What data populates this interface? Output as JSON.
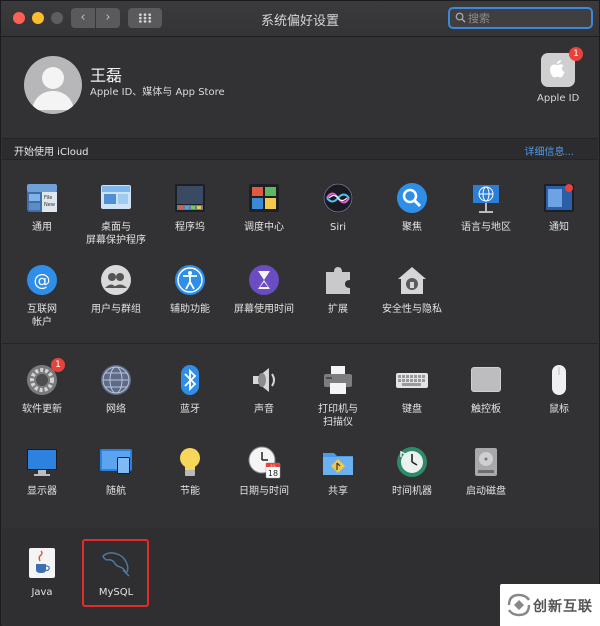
{
  "window": {
    "title": "系统偏好设置",
    "search_placeholder": "搜索"
  },
  "account": {
    "name": "王磊",
    "subtitle": "Apple ID、媒体与 App Store",
    "appleid_label": "Apple ID",
    "appleid_badge": "1"
  },
  "icloud": {
    "text": "开始使用 iCloud",
    "link": "详细信息..."
  },
  "row1": [
    {
      "label": "通用"
    },
    {
      "label": "桌面与\n屏幕保护程序"
    },
    {
      "label": "程序坞"
    },
    {
      "label": "调度中心"
    },
    {
      "label": "Siri"
    },
    {
      "label": "聚焦"
    },
    {
      "label": "语言与地区"
    },
    {
      "label": "通知"
    }
  ],
  "row2": [
    {
      "label": "互联网\n帐户"
    },
    {
      "label": "用户与群组"
    },
    {
      "label": "辅助功能"
    },
    {
      "label": "屏幕使用时间"
    },
    {
      "label": "扩展"
    },
    {
      "label": "安全性与隐私"
    }
  ],
  "row3": [
    {
      "label": "软件更新",
      "badge": "1"
    },
    {
      "label": "网络"
    },
    {
      "label": "蓝牙"
    },
    {
      "label": "声音"
    },
    {
      "label": "打印机与\n扫描仪"
    },
    {
      "label": "键盘"
    },
    {
      "label": "触控板"
    },
    {
      "label": "鼠标"
    }
  ],
  "row4": [
    {
      "label": "显示器"
    },
    {
      "label": "随航"
    },
    {
      "label": "节能"
    },
    {
      "label": "日期与时间",
      "calendar_day": "18",
      "calendar_month": "JUL"
    },
    {
      "label": "共享"
    },
    {
      "label": "时间机器"
    },
    {
      "label": "启动磁盘"
    }
  ],
  "other": [
    {
      "label": "Java"
    },
    {
      "label": "MySQL"
    }
  ],
  "watermark": {
    "text": "创新互联"
  }
}
